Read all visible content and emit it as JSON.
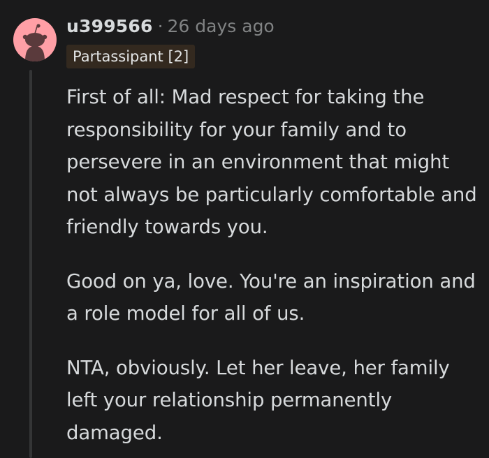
{
  "comment": {
    "username": "u399566",
    "separator": "·",
    "timestamp": "26 days ago",
    "flair": "Partassipant [2]",
    "paragraphs": [
      "First of all: Mad respect for taking the responsibility for your family and to persevere in an environment that might not always be particularly comfortable and friendly towards you.",
      "Good on ya, love. You're an inspiration and a role model for all of us.",
      "NTA, obviously. Let her leave, her family left your relationship permanently damaged."
    ]
  },
  "colors": {
    "background": "#1a1a1b",
    "text": "#d7dadc",
    "meta_text": "#818384",
    "avatar_bg": "#ff9fa6",
    "flair_bg": "#33291f",
    "thread_line": "#343536"
  },
  "icons": {
    "avatar": "reddit-snoo-avatar-icon"
  }
}
